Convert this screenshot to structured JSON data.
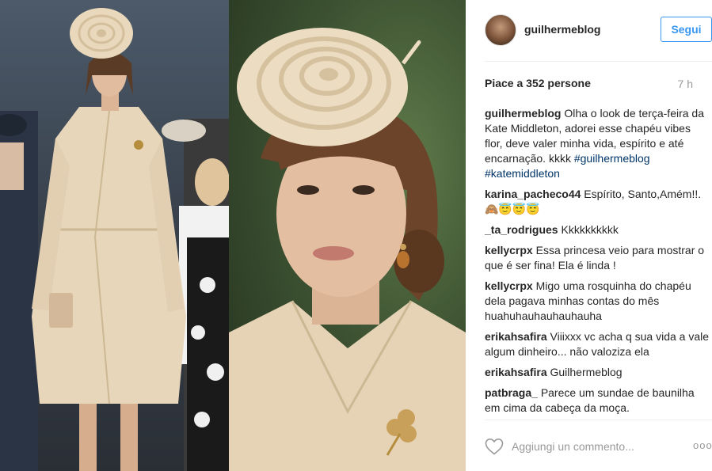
{
  "post": {
    "username": "guilhermeblog",
    "follow_label": "Segui",
    "likes_text": "Piace a 352 persone",
    "time_ago": "7 h"
  },
  "comments": [
    {
      "user": "guilhermeblog",
      "text": "Olha o look de terça-feira da Kate Middleton, adorei esse chapéu vibes flor, deve valer minha vida, espírito e até encarnação. kkkk",
      "hashtags": [
        "#guilhermeblog",
        "#katemiddleton"
      ]
    },
    {
      "user": "karina_pacheco44",
      "text": "Espírito, Santo,Amém!!.",
      "emoji": "🙈😇😇😇"
    },
    {
      "user": "_ta_rodrigues",
      "text": "Kkkkkkkkkk"
    },
    {
      "user": "kellycrpx",
      "text": "Essa princesa veio para mostrar o que é ser fina! Ela é linda !"
    },
    {
      "user": "kellycrpx",
      "text": "Migo uma rosquinha do chapéu dela pagava minhas contas do mês huahuhauhauhauhauha"
    },
    {
      "user": "erikahsafira",
      "text": "Viiixxx vc acha q sua vida a vale algum dinheiro... não valoziza ela"
    },
    {
      "user": "erikahsafira",
      "text": "Guilhermeblog"
    },
    {
      "user": "patbraga_",
      "text": "Parece um sundae de baunilha em cima da cabeça da moça."
    }
  ],
  "comment_box": {
    "placeholder": "Aggiungi un commento...",
    "more_label": "ooo"
  },
  "icons": {
    "like": "heart-icon",
    "options": "more-options-icon"
  },
  "colors": {
    "link_blue": "#3897f0",
    "hashtag_blue": "#003569",
    "muted": "#999999",
    "coat": "#e6d3b6"
  }
}
